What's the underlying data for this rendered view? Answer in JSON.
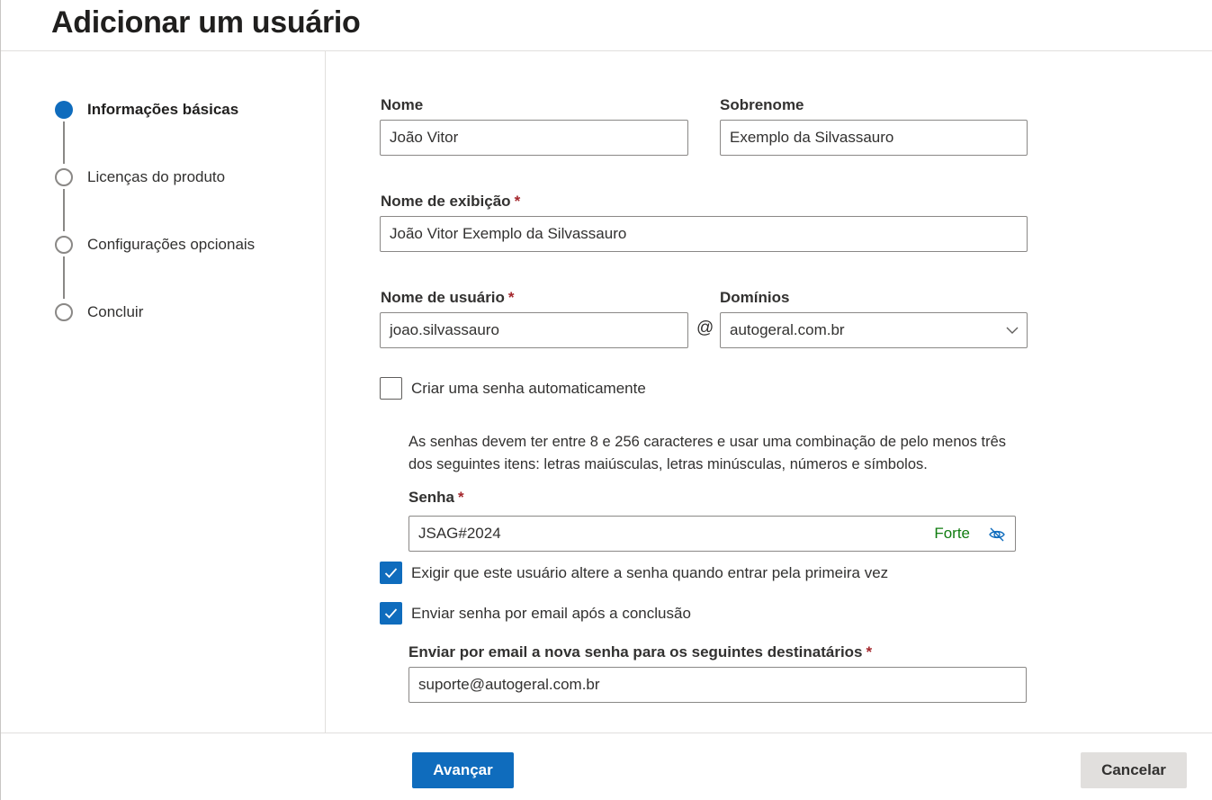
{
  "title": "Adicionar um usuário",
  "steps": [
    {
      "label": "Informações básicas",
      "state": "active"
    },
    {
      "label": "Licenças do produto",
      "state": "pending"
    },
    {
      "label": "Configurações opcionais",
      "state": "pending"
    },
    {
      "label": "Concluir",
      "state": "pending"
    }
  ],
  "form": {
    "first_name": {
      "label": "Nome",
      "value": "João Vitor"
    },
    "last_name": {
      "label": "Sobrenome",
      "value": "Exemplo da Silvassauro"
    },
    "display_name": {
      "label": "Nome de exibição",
      "required_mark": "*",
      "value": "João Vitor Exemplo da Silvassauro"
    },
    "username": {
      "label": "Nome de usuário",
      "required_mark": "*",
      "value": "joao.silvassauro"
    },
    "at_symbol": "@",
    "domain": {
      "label": "Domínios",
      "value": "autogeral.com.br"
    },
    "auto_password": {
      "label": "Criar uma senha automaticamente",
      "checked": false
    },
    "password_hint": "As senhas devem ter entre 8 e 256 caracteres e usar uma combinação de pelo menos três dos seguintes itens: letras maiúsculas, letras minúsculas, números e símbolos.",
    "password": {
      "label": "Senha",
      "required_mark": "*",
      "value": "JSAG#2024",
      "strength": "Forte",
      "strength_color": "#107c10"
    },
    "require_change": {
      "label": "Exigir que este usuário altere a senha quando entrar pela primeira vez",
      "checked": true
    },
    "email_password": {
      "label": "Enviar senha por email após a conclusão",
      "checked": true
    },
    "recipients": {
      "label": "Enviar por email a nova senha para os seguintes destinatários",
      "required_mark": "*",
      "value": "suporte@autogeral.com.br"
    }
  },
  "footer": {
    "next_label": "Avançar",
    "cancel_label": "Cancelar"
  },
  "colors": {
    "accent": "#0f6cbd",
    "required": "#a4262c"
  },
  "icons": [
    "chevron-down-icon",
    "eye-off-icon",
    "checkmark-icon"
  ]
}
